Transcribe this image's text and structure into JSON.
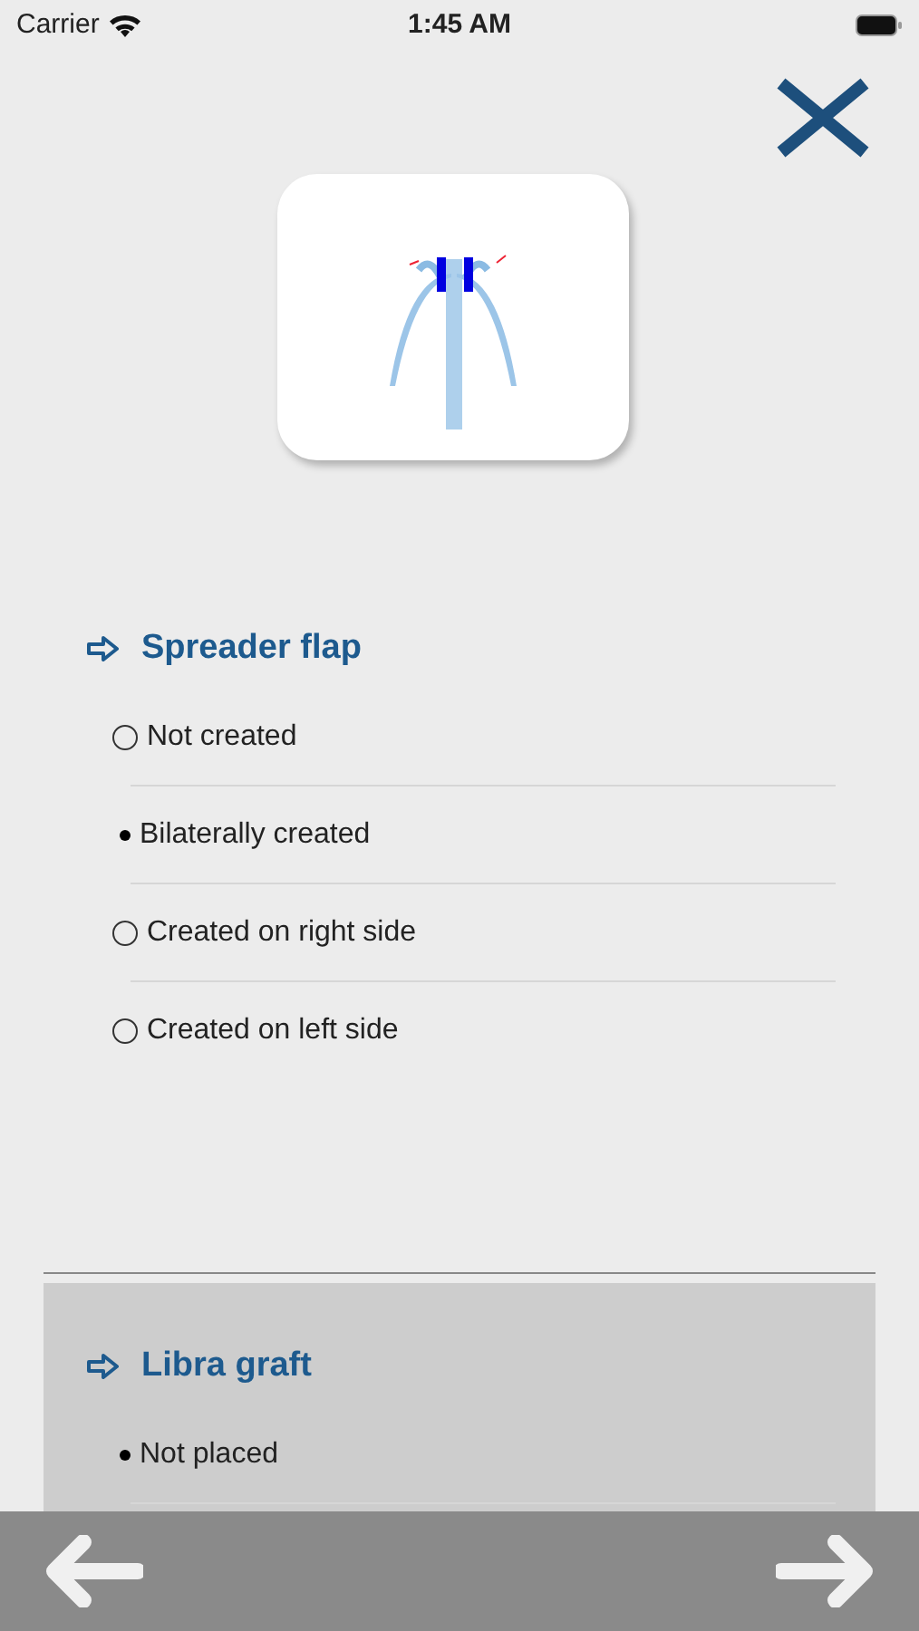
{
  "status_bar": {
    "carrier": "Carrier",
    "time": "1:45 AM"
  },
  "sections": [
    {
      "title": "Spreader flap",
      "shaded": false,
      "options": [
        {
          "label": "Not created",
          "selected": false
        },
        {
          "label": "Bilaterally created",
          "selected": true
        },
        {
          "label": "Created on right side",
          "selected": false
        },
        {
          "label": "Created on left side",
          "selected": false
        }
      ]
    },
    {
      "title": "Libra graft",
      "shaded": true,
      "options": [
        {
          "label": "Not placed",
          "selected": true
        }
      ]
    }
  ]
}
